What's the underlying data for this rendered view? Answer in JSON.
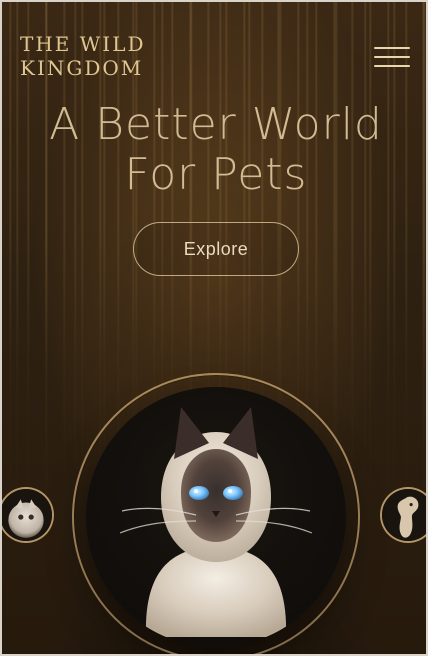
{
  "brand": {
    "name_line1": "THE WILD",
    "name_line2": "KINGDOM"
  },
  "hero": {
    "title_line1": "A Better World",
    "title_line2": "For Pets",
    "cta_label": "Explore"
  },
  "icons": {
    "menu": "menu-icon"
  },
  "colors": {
    "gold": "#e8cf98",
    "bronze_bg": "#2f2111",
    "ring": "#e8c084"
  }
}
